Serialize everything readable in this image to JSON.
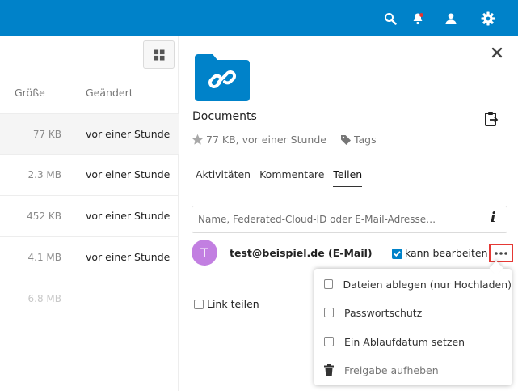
{
  "header": {
    "icons": [
      "search-icon",
      "notifications-icon",
      "contacts-icon",
      "settings-icon"
    ],
    "colors": {
      "bar": "#0082c9",
      "notification_dot": "#e9322d"
    }
  },
  "filelist": {
    "columns": {
      "size": "Größe",
      "modified": "Geändert"
    },
    "rows": [
      {
        "size": "77 KB",
        "modified": "vor einer Stunde"
      },
      {
        "size": "2.3 MB",
        "modified": "vor einer Stunde"
      },
      {
        "size": "452 KB",
        "modified": "vor einer Stunde"
      },
      {
        "size": "4.1 MB",
        "modified": "vor einer Stunde"
      },
      {
        "size": "6.8 MB",
        "modified": ""
      }
    ]
  },
  "details": {
    "name": "Documents",
    "meta": "77 KB, vor einer Stunde",
    "tags_label": "Tags",
    "tabs": [
      "Aktivitäten",
      "Kommentare",
      "Teilen"
    ],
    "active_tab": "Teilen"
  },
  "sharing": {
    "placeholder": "Name, Federated-Cloud-ID oder E-Mail-Adresse…",
    "sharee": {
      "avatar_letter": "T",
      "avatar_color": "#c27fe1",
      "label": "test@beispiel.de (E-Mail)",
      "can_edit_label": "kann bearbeiten",
      "can_edit": true
    },
    "link_share_label": "Link teilen",
    "menu": {
      "upload_only": "Dateien ablegen (nur Hochladen)",
      "password": "Passwortschutz",
      "expiration": "Ein Ablaufdatum setzen",
      "unshare": "Freigabe aufheben"
    }
  }
}
